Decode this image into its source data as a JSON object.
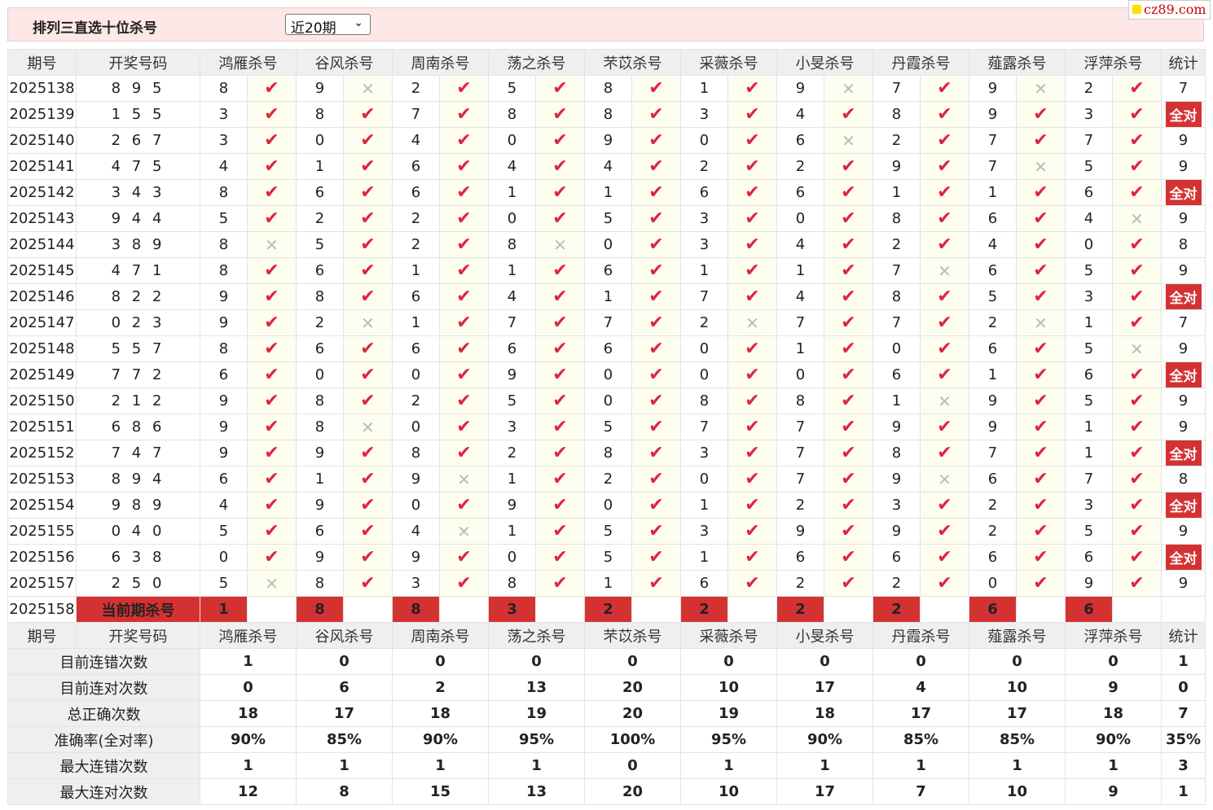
{
  "header": {
    "title": "排列三直选十位杀号",
    "select_value": "近20期",
    "brand": "cz89.com"
  },
  "columns": {
    "period": "期号",
    "draw": "开奖号码",
    "experts": [
      "鸿雁杀号",
      "谷风杀号",
      "周南杀号",
      "荡之杀号",
      "芣苡杀号",
      "采薇杀号",
      "小旻杀号",
      "丹霞杀号",
      "薤露杀号",
      "浮萍杀号"
    ],
    "stat": "统计"
  },
  "rows": [
    {
      "period": "2025138",
      "draw": "8 9 5",
      "kills": [
        "8",
        "9",
        "2",
        "5",
        "8",
        "1",
        "9",
        "7",
        "9",
        "2"
      ],
      "ok": [
        1,
        0,
        1,
        1,
        1,
        1,
        0,
        1,
        0,
        1
      ],
      "stat": "7"
    },
    {
      "period": "2025139",
      "draw": "1 5 5",
      "kills": [
        "3",
        "8",
        "7",
        "8",
        "8",
        "3",
        "4",
        "8",
        "9",
        "3"
      ],
      "ok": [
        1,
        1,
        1,
        1,
        1,
        1,
        1,
        1,
        1,
        1
      ],
      "stat": "全对"
    },
    {
      "period": "2025140",
      "draw": "2 6 7",
      "kills": [
        "3",
        "0",
        "4",
        "0",
        "9",
        "0",
        "6",
        "2",
        "7",
        "7"
      ],
      "ok": [
        1,
        1,
        1,
        1,
        1,
        1,
        0,
        1,
        1,
        1
      ],
      "stat": "9"
    },
    {
      "period": "2025141",
      "draw": "4 7 5",
      "kills": [
        "4",
        "1",
        "6",
        "4",
        "4",
        "2",
        "2",
        "9",
        "7",
        "5"
      ],
      "ok": [
        1,
        1,
        1,
        1,
        1,
        1,
        1,
        1,
        0,
        1
      ],
      "stat": "9"
    },
    {
      "period": "2025142",
      "draw": "3 4 3",
      "kills": [
        "8",
        "6",
        "6",
        "1",
        "1",
        "6",
        "6",
        "1",
        "1",
        "6"
      ],
      "ok": [
        1,
        1,
        1,
        1,
        1,
        1,
        1,
        1,
        1,
        1
      ],
      "stat": "全对"
    },
    {
      "period": "2025143",
      "draw": "9 4 4",
      "kills": [
        "5",
        "2",
        "2",
        "0",
        "5",
        "3",
        "0",
        "8",
        "6",
        "4"
      ],
      "ok": [
        1,
        1,
        1,
        1,
        1,
        1,
        1,
        1,
        1,
        0
      ],
      "stat": "9"
    },
    {
      "period": "2025144",
      "draw": "3 8 9",
      "kills": [
        "8",
        "5",
        "2",
        "8",
        "0",
        "3",
        "4",
        "2",
        "4",
        "0"
      ],
      "ok": [
        0,
        1,
        1,
        0,
        1,
        1,
        1,
        1,
        1,
        1
      ],
      "stat": "8"
    },
    {
      "period": "2025145",
      "draw": "4 7 1",
      "kills": [
        "8",
        "6",
        "1",
        "1",
        "6",
        "1",
        "1",
        "7",
        "6",
        "5"
      ],
      "ok": [
        1,
        1,
        1,
        1,
        1,
        1,
        1,
        0,
        1,
        1
      ],
      "stat": "9"
    },
    {
      "period": "2025146",
      "draw": "8 2 2",
      "kills": [
        "9",
        "8",
        "6",
        "4",
        "1",
        "7",
        "4",
        "8",
        "5",
        "3"
      ],
      "ok": [
        1,
        1,
        1,
        1,
        1,
        1,
        1,
        1,
        1,
        1
      ],
      "stat": "全对"
    },
    {
      "period": "2025147",
      "draw": "0 2 3",
      "kills": [
        "9",
        "2",
        "1",
        "7",
        "7",
        "2",
        "7",
        "7",
        "2",
        "1"
      ],
      "ok": [
        1,
        0,
        1,
        1,
        1,
        0,
        1,
        1,
        0,
        1
      ],
      "stat": "7"
    },
    {
      "period": "2025148",
      "draw": "5 5 7",
      "kills": [
        "8",
        "6",
        "6",
        "6",
        "6",
        "0",
        "1",
        "0",
        "6",
        "5"
      ],
      "ok": [
        1,
        1,
        1,
        1,
        1,
        1,
        1,
        1,
        1,
        0
      ],
      "stat": "9"
    },
    {
      "period": "2025149",
      "draw": "7 7 2",
      "kills": [
        "6",
        "0",
        "0",
        "9",
        "0",
        "0",
        "0",
        "6",
        "1",
        "6"
      ],
      "ok": [
        1,
        1,
        1,
        1,
        1,
        1,
        1,
        1,
        1,
        1
      ],
      "stat": "全对"
    },
    {
      "period": "2025150",
      "draw": "2 1 2",
      "kills": [
        "9",
        "8",
        "2",
        "5",
        "0",
        "8",
        "8",
        "1",
        "9",
        "5"
      ],
      "ok": [
        1,
        1,
        1,
        1,
        1,
        1,
        1,
        0,
        1,
        1
      ],
      "stat": "9"
    },
    {
      "period": "2025151",
      "draw": "6 8 6",
      "kills": [
        "9",
        "8",
        "0",
        "3",
        "5",
        "7",
        "7",
        "9",
        "9",
        "1"
      ],
      "ok": [
        1,
        0,
        1,
        1,
        1,
        1,
        1,
        1,
        1,
        1
      ],
      "stat": "9"
    },
    {
      "period": "2025152",
      "draw": "7 4 7",
      "kills": [
        "9",
        "9",
        "8",
        "2",
        "8",
        "3",
        "7",
        "8",
        "7",
        "1"
      ],
      "ok": [
        1,
        1,
        1,
        1,
        1,
        1,
        1,
        1,
        1,
        1
      ],
      "stat": "全对"
    },
    {
      "period": "2025153",
      "draw": "8 9 4",
      "kills": [
        "6",
        "1",
        "9",
        "1",
        "2",
        "0",
        "7",
        "9",
        "6",
        "7"
      ],
      "ok": [
        1,
        1,
        0,
        1,
        1,
        1,
        1,
        0,
        1,
        1
      ],
      "stat": "8"
    },
    {
      "period": "2025154",
      "draw": "9 8 9",
      "kills": [
        "4",
        "9",
        "0",
        "9",
        "0",
        "1",
        "2",
        "3",
        "2",
        "3"
      ],
      "ok": [
        1,
        1,
        1,
        1,
        1,
        1,
        1,
        1,
        1,
        1
      ],
      "stat": "全对"
    },
    {
      "period": "2025155",
      "draw": "0 4 0",
      "kills": [
        "5",
        "6",
        "4",
        "1",
        "5",
        "3",
        "9",
        "9",
        "2",
        "5"
      ],
      "ok": [
        1,
        1,
        0,
        1,
        1,
        1,
        1,
        1,
        1,
        1
      ],
      "stat": "9"
    },
    {
      "period": "2025156",
      "draw": "6 3 8",
      "kills": [
        "0",
        "9",
        "9",
        "0",
        "5",
        "1",
        "6",
        "6",
        "6",
        "6"
      ],
      "ok": [
        1,
        1,
        1,
        1,
        1,
        1,
        1,
        1,
        1,
        1
      ],
      "stat": "全对"
    },
    {
      "period": "2025157",
      "draw": "2 5 0",
      "kills": [
        "5",
        "8",
        "3",
        "8",
        "1",
        "6",
        "2",
        "2",
        "0",
        "9"
      ],
      "ok": [
        0,
        1,
        1,
        1,
        1,
        1,
        1,
        1,
        1,
        1
      ],
      "stat": "9"
    }
  ],
  "current": {
    "period": "2025158",
    "label": "当前期杀号",
    "kills": [
      "1",
      "8",
      "8",
      "3",
      "2",
      "2",
      "2",
      "2",
      "6",
      "6"
    ]
  },
  "stats": [
    {
      "label": "目前连错次数",
      "values": [
        "1",
        "0",
        "0",
        "0",
        "0",
        "0",
        "0",
        "0",
        "0",
        "0"
      ],
      "stat": "1",
      "color": "blue"
    },
    {
      "label": "目前连对次数",
      "values": [
        "0",
        "6",
        "2",
        "13",
        "20",
        "10",
        "17",
        "4",
        "10",
        "9"
      ],
      "stat": "0",
      "color": "blue"
    },
    {
      "label": "总正确次数",
      "values": [
        "18",
        "17",
        "18",
        "19",
        "20",
        "19",
        "18",
        "17",
        "17",
        "18"
      ],
      "stat": "7",
      "color": "blue"
    },
    {
      "label": "准确率(全对率)",
      "values": [
        "90%",
        "85%",
        "90%",
        "95%",
        "100%",
        "95%",
        "90%",
        "85%",
        "85%",
        "90%"
      ],
      "stat": "35%",
      "color": "red"
    },
    {
      "label": "最大连错次数",
      "values": [
        "1",
        "1",
        "1",
        "1",
        "0",
        "1",
        "1",
        "1",
        "1",
        "1"
      ],
      "stat": "3",
      "color": "blue"
    },
    {
      "label": "最大连对次数",
      "values": [
        "12",
        "8",
        "15",
        "13",
        "20",
        "10",
        "17",
        "7",
        "10",
        "9"
      ],
      "stat": "1",
      "color": "blue"
    }
  ],
  "icons": {
    "correct": "check-icon",
    "wrong": "cross-icon"
  },
  "colors": {
    "accent_red": "#d43232",
    "check_red": "#e0243a",
    "stat_blue": "#1a1ad8",
    "header_pink": "#fde7e7"
  }
}
